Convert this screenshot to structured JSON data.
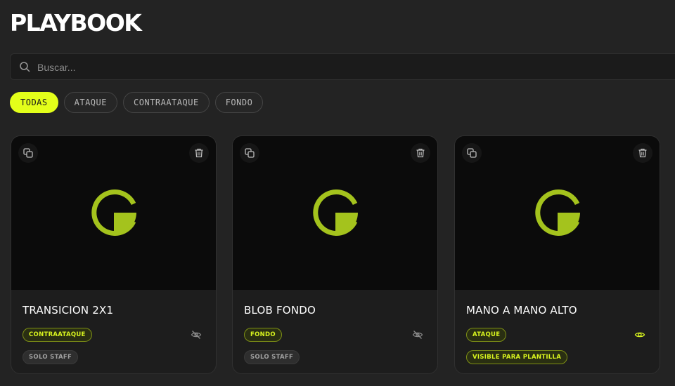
{
  "header": {
    "title": "PLAYBOOK"
  },
  "search": {
    "placeholder": "Buscar..."
  },
  "filters": [
    {
      "label": "TODAS",
      "active": true
    },
    {
      "label": "ATAQUE",
      "active": false
    },
    {
      "label": "CONTRAATAQUE",
      "active": false
    },
    {
      "label": "FONDO",
      "active": false
    }
  ],
  "colors": {
    "accent": "#e3ff1a",
    "logo": "#a4c31d",
    "background": "#232323"
  },
  "cards": [
    {
      "title": "TRANSICION 2X1",
      "category": "CONTRAATAQUE",
      "visibility": "SOLO STAFF",
      "visibility_icon": "eye-off-icon"
    },
    {
      "title": "BLOB FONDO",
      "category": "FONDO",
      "visibility": "SOLO STAFF",
      "visibility_icon": "eye-off-icon"
    },
    {
      "title": "MANO A MANO ALTO",
      "category": "ATAQUE",
      "visibility": "VISIBLE PARA PLANTILLA",
      "visibility_icon": "eye-icon"
    }
  ]
}
